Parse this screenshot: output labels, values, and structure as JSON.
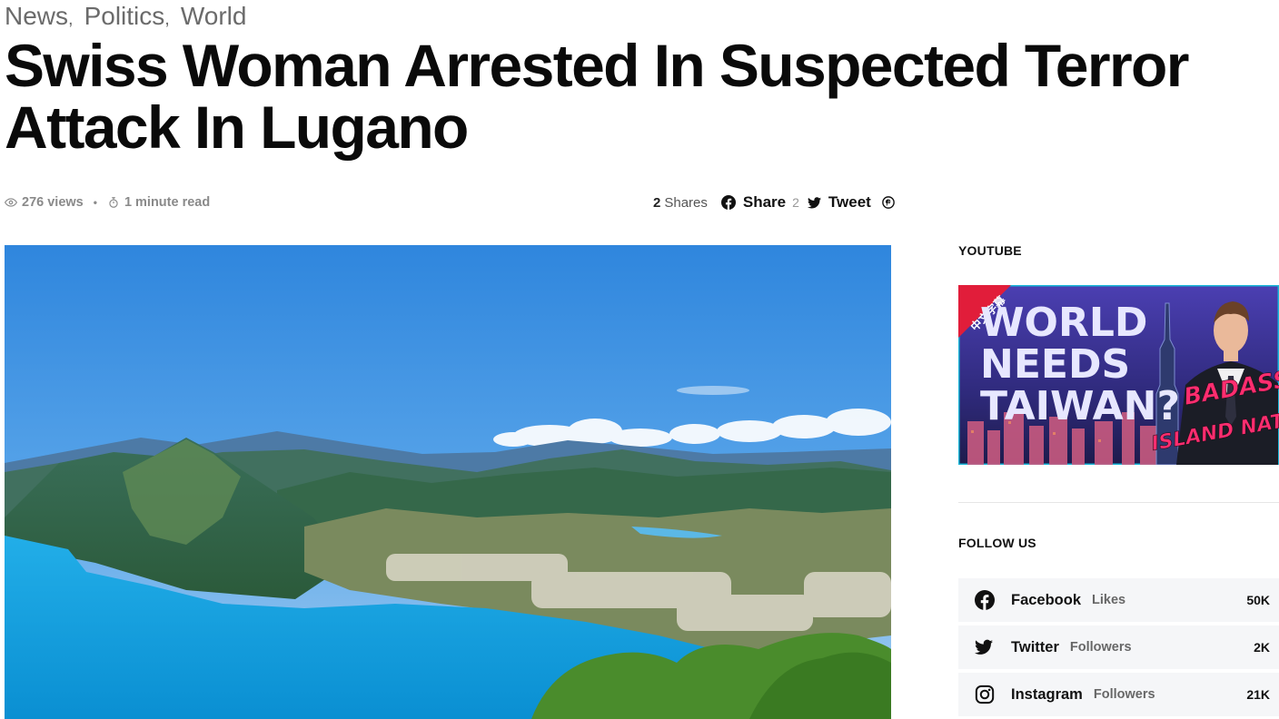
{
  "categories": [
    "News",
    "Politics",
    "World"
  ],
  "headline": "Swiss Woman Arrested In Suspected Terror Attack In Lugano",
  "meta": {
    "views": "276 views",
    "read_time": "1 minute read"
  },
  "share": {
    "count": "2",
    "count_label": "Shares",
    "facebook_label": "Share",
    "facebook_count": "2",
    "twitter_label": "Tweet"
  },
  "sidebar": {
    "youtube_title": "YOUTUBE",
    "thumbnail": {
      "corner_tag": "中文字幕",
      "headline": [
        "WORLD",
        "NEEDS",
        "TAIWAN?"
      ],
      "script_text": [
        "BADASS",
        "ISLAND NATION"
      ]
    },
    "follow_title": "FOLLOW US",
    "follow": [
      {
        "name": "Facebook",
        "label": "Likes",
        "count": "50K",
        "icon": "facebook-icon"
      },
      {
        "name": "Twitter",
        "label": "Followers",
        "count": "2K",
        "icon": "twitter-icon"
      },
      {
        "name": "Instagram",
        "label": "Followers",
        "count": "21K",
        "icon": "instagram-icon"
      }
    ]
  },
  "colors": {
    "accent": "#111111",
    "muted": "#8a8a8a",
    "lake": "#16a3e0",
    "sky": "#3f92e0"
  }
}
